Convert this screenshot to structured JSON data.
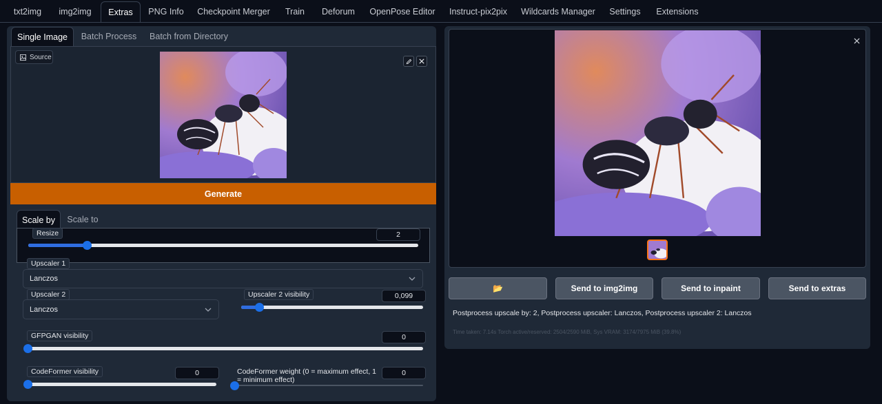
{
  "top_tabs": [
    {
      "label": "txt2img"
    },
    {
      "label": "img2img"
    },
    {
      "label": "Extras"
    },
    {
      "label": "PNG Info"
    },
    {
      "label": "Checkpoint Merger"
    },
    {
      "label": "Train"
    },
    {
      "label": "Deforum"
    },
    {
      "label": "OpenPose Editor"
    },
    {
      "label": "Instruct-pix2pix"
    },
    {
      "label": "Wildcards Manager"
    },
    {
      "label": "Settings"
    },
    {
      "label": "Extensions"
    }
  ],
  "sub_tabs": [
    {
      "label": "Single Image"
    },
    {
      "label": "Batch Process"
    },
    {
      "label": "Batch from Directory"
    }
  ],
  "source_label": "Source",
  "generate_label": "Generate",
  "scale_tabs": [
    {
      "label": "Scale by"
    },
    {
      "label": "Scale to"
    }
  ],
  "resize": {
    "label": "Resize",
    "value": "2",
    "fraction": 0.15
  },
  "upscaler1": {
    "label": "Upscaler 1",
    "value": "Lanczos"
  },
  "upscaler2": {
    "label": "Upscaler 2",
    "value": "Lanczos"
  },
  "upscaler2_visibility": {
    "label": "Upscaler 2 visibility",
    "value": "0,099",
    "fraction": 0.099
  },
  "gfpgan": {
    "label": "GFPGAN visibility",
    "value": "0",
    "fraction": 0
  },
  "codeformer_visibility": {
    "label": "CodeFormer visibility",
    "value": "0",
    "fraction": 0
  },
  "codeformer_weight": {
    "label": "CodeFormer weight (0 = maximum effect, 1 = minimum effect)",
    "value": "0",
    "fraction": 0
  },
  "output_buttons": {
    "folder": "📂",
    "send_img2img": "Send to img2img",
    "send_inpaint": "Send to inpaint",
    "send_extras": "Send to extras"
  },
  "info_text": "Postprocess upscale by: 2, Postprocess upscaler: Lanczos, Postprocess upscaler 2: Lanczos",
  "timing_text": "Time taken: 7.14s  Torch active/reserved: 2504/2590 MiB, Sys VRAM: 3174/7975 MiB (39.8%)",
  "colors": {
    "accent": "#c85f00",
    "slider": "#1b6fe8",
    "background": "#0b0f19",
    "panel": "#1f2937"
  }
}
